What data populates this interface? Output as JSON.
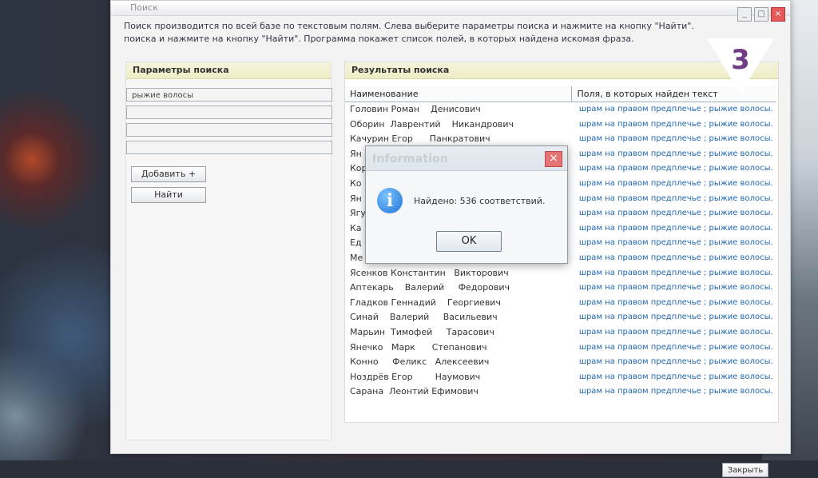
{
  "window": {
    "title": "Поиск"
  },
  "intro": {
    "line1": "Поиск производится по всей базе по текстовым полям. Слева выберите параметры поиска и нажмите на кнопку \"Найти\".",
    "line2": "поиска и нажмите на кнопку \"Найти\". Программа покажет список полей, в которых найдена искомая фраза."
  },
  "left_panel": {
    "header": "Параметры поиска",
    "fields": [
      "рыжие волосы",
      "",
      "",
      ""
    ],
    "add_button": "Добавить +",
    "find_button": "Найти"
  },
  "right_panel": {
    "header": "Результаты поиска",
    "columns": [
      "Наименование",
      "Поля, в которых найден текст"
    ],
    "rows": [
      {
        "name": "Головин Роман    Денисович",
        "fields": "шрам на правом предплечье ; рыжие волосы."
      },
      {
        "name": "Оборин  Лаврентий    Никандрович",
        "fields": "шрам на правом предплечье ; рыжие волосы."
      },
      {
        "name": "Качурин Егор      Панкратович",
        "fields": "шрам на правом предплечье ; рыжие волосы."
      },
      {
        "name": "Ян",
        "fields": "шрам на правом предплечье ; рыжие волосы."
      },
      {
        "name": "Кор",
        "fields": "шрам на правом предплечье ; рыжие волосы."
      },
      {
        "name": "Ко",
        "fields": "шрам на правом предплечье ; рыжие волосы."
      },
      {
        "name": "Ян",
        "fields": "шрам на правом предплечье ; рыжие волосы."
      },
      {
        "name": "Ягу",
        "fields": "шрам на правом предплечье ; рыжие волосы."
      },
      {
        "name": "Ка",
        "fields": "шрам на правом предплечье ; рыжие волосы."
      },
      {
        "name": "Ед",
        "fields": "шрам на правом предплечье ; рыжие волосы."
      },
      {
        "name": "Ме",
        "fields": "шрам на правом предплечье ; рыжие волосы."
      },
      {
        "name": "Ясенков Константин   Викторович",
        "fields": "шрам на правом предплечье ; рыжие волосы."
      },
      {
        "name": "Аптекарь    Валерий     Федорович",
        "fields": "шрам на правом предплечье ; рыжие волосы."
      },
      {
        "name": "Гладков Геннадий    Георгиевич",
        "fields": "шрам на правом предплечье ; рыжие волосы."
      },
      {
        "name": "Синай    Валерий     Васильевич",
        "fields": "шрам на правом предплечье ; рыжие волосы."
      },
      {
        "name": "Марьин  Тимофей     Тарасович",
        "fields": "шрам на правом предплечье ; рыжие волосы."
      },
      {
        "name": "Янечко   Марк      Степанович",
        "fields": "шрам на правом предплечье ; рыжие волосы."
      },
      {
        "name": "Конно     Феликс   Алексеевич",
        "fields": "шрам на правом предплечье ; рыжие волосы."
      },
      {
        "name": "Ноздрёв Егор        Наумович",
        "fields": "шрам на правом предплечье ; рыжие волосы."
      },
      {
        "name": "Сарана  Леонтий Ефимович",
        "fields": "шрам на правом предплечье ; рыжие волосы."
      }
    ],
    "close_button": "Закрыть"
  },
  "dialog": {
    "title": "Information",
    "message": "Найдено: 536 соответствий.",
    "ok_button": "OK",
    "icon": "info-icon"
  },
  "logo": {
    "text": "3",
    "colors": {
      "triangle": "#ffffff",
      "digit": "#6f3c86"
    }
  }
}
